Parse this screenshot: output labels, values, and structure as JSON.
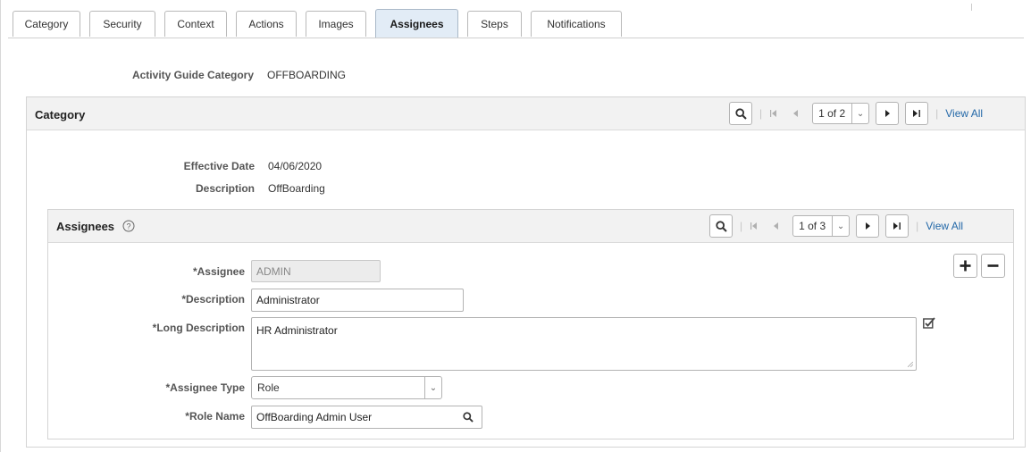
{
  "tabs": [
    {
      "label": "Category",
      "active": false
    },
    {
      "label": "Security",
      "active": false
    },
    {
      "label": "Context",
      "active": false
    },
    {
      "label": "Actions",
      "active": false
    },
    {
      "label": "Images",
      "active": false
    },
    {
      "label": "Assignees",
      "active": true
    },
    {
      "label": "Steps",
      "active": false
    },
    {
      "label": "Notifications",
      "active": false
    }
  ],
  "header": {
    "label": "Activity Guide Category",
    "value": "OFFBOARDING"
  },
  "category": {
    "title": "Category",
    "page_indicator": "1 of 2",
    "view_all": "View All",
    "effective_date_label": "Effective Date",
    "effective_date": "04/06/2020",
    "description_label": "Description",
    "description": "OffBoarding"
  },
  "assignees": {
    "title": "Assignees",
    "page_indicator": "1 of 3",
    "view_all": "View All",
    "assignee_label": "*Assignee",
    "assignee_value": "ADMIN",
    "description_label": "*Description",
    "description_value": "Administrator",
    "long_description_label": "*Long Description",
    "long_description_value": "HR Administrator",
    "assignee_type_label": "*Assignee Type",
    "assignee_type_value": "Role",
    "role_name_label": "*Role Name",
    "role_name_value": "OffBoarding Admin User"
  },
  "icons": {
    "search": "search-icon",
    "first": "first-page-icon",
    "prev": "previous-icon",
    "next": "next-icon",
    "last": "last-page-icon",
    "help": "help-icon",
    "add": "add-icon",
    "remove": "remove-icon",
    "edit": "spell-check-icon"
  }
}
